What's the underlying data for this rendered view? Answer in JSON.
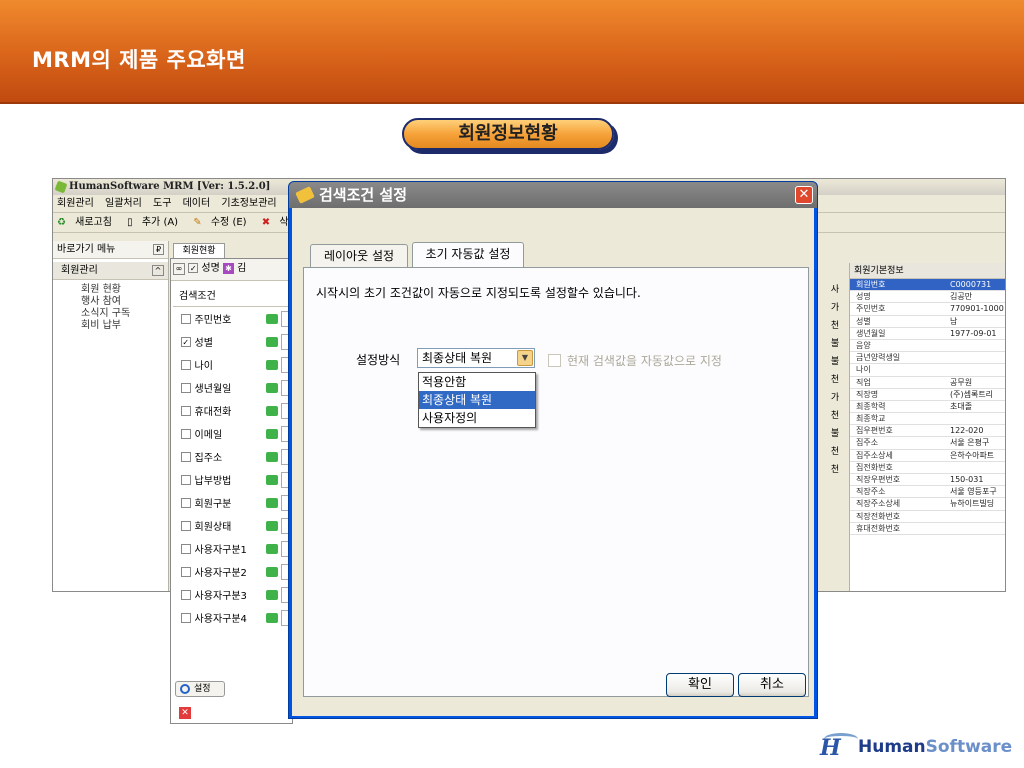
{
  "slide": {
    "title": "MRM의 제품 주요화면",
    "pill_label": "회원정보현황"
  },
  "app": {
    "title": "HumanSoftware MRM [Ver: 1.5.2.0]",
    "menu": [
      "회원관리",
      "일괄처리",
      "도구",
      "데이터",
      "기초정보관리"
    ],
    "toolbar": [
      "새로고침",
      "추가 (A)",
      "수정 (E)",
      "삭제(D"
    ],
    "nav_head": "바로가기 메뉴",
    "nav_group": "회원관리",
    "nav_items": [
      "회원 현황",
      "행사 참여",
      "소식지 구독",
      "회비 납부"
    ],
    "tab_member": "회원현황",
    "mid_column": [
      "사",
      "가",
      "천",
      "불",
      "불",
      "천",
      "가",
      "천",
      "불",
      "천",
      "천"
    ],
    "right_panel": {
      "title": "회원기본정보",
      "rows": [
        {
          "k": "회원번호",
          "v": "C0000731",
          "sel": true
        },
        {
          "k": "성명",
          "v": "김공만"
        },
        {
          "k": "주민번호",
          "v": "770901-1000"
        },
        {
          "k": "성별",
          "v": "남"
        },
        {
          "k": "생년월일",
          "v": "1977-09-01"
        },
        {
          "k": "음양",
          "v": ""
        },
        {
          "k": "금년양력생일",
          "v": ""
        },
        {
          "k": "나이",
          "v": ""
        },
        {
          "k": "직업",
          "v": "공무원"
        },
        {
          "k": "직장명",
          "v": "(주)셈록트리"
        },
        {
          "k": "최종학력",
          "v": "초대졸"
        },
        {
          "k": "최종학교",
          "v": ""
        },
        {
          "k": "집우편번호",
          "v": "122-020"
        },
        {
          "k": "집주소",
          "v": "서울 은평구"
        },
        {
          "k": "집주소상세",
          "v": "은하수아파트"
        },
        {
          "k": "집전화번호",
          "v": ""
        },
        {
          "k": "직장우편번호",
          "v": "150-031"
        },
        {
          "k": "직장주소",
          "v": "서울 영등포구"
        },
        {
          "k": "직장주소상세",
          "v": "뉴하이트빌딩"
        },
        {
          "k": "직장전화번호",
          "v": ""
        },
        {
          "k": "휴대전화번호",
          "v": ""
        }
      ]
    }
  },
  "search_panel": {
    "top_label": "성명",
    "top_value": "김",
    "header": "검색조건",
    "rows": [
      {
        "label": "주민번호",
        "checked": false
      },
      {
        "label": "성별",
        "checked": true
      },
      {
        "label": "나이",
        "checked": false
      },
      {
        "label": "생년월일",
        "checked": false
      },
      {
        "label": "휴대전화",
        "checked": false
      },
      {
        "label": "이메일",
        "checked": false
      },
      {
        "label": "집주소",
        "checked": false
      },
      {
        "label": "납부방법",
        "checked": false
      },
      {
        "label": "회원구분",
        "checked": false
      },
      {
        "label": "회원상태",
        "checked": false
      },
      {
        "label": "사용자구분1",
        "checked": false
      },
      {
        "label": "사용자구분2",
        "checked": false
      },
      {
        "label": "사용자구분3",
        "checked": false
      },
      {
        "label": "사용자구분4",
        "checked": false
      }
    ],
    "settings_button": "설정"
  },
  "dialog": {
    "title": "검색조건 설정",
    "tabs": [
      "레이아웃 설정",
      "초기 자동값 설정"
    ],
    "description": "시작시의 초기 조건값이 자동으로 지정되도록 설정할수 있습니다.",
    "mode_label": "설정방식",
    "combo_value": "최종상태 복원",
    "options": [
      "적용안함",
      "최종상태 복원",
      "사용자정의"
    ],
    "selected_option_index": 1,
    "checkbox_label": "현재 검색값을 자동값으로 지정",
    "ok_label": "확인",
    "cancel_label": "취소"
  },
  "logo": {
    "part1": "Human",
    "part2": "Software"
  }
}
